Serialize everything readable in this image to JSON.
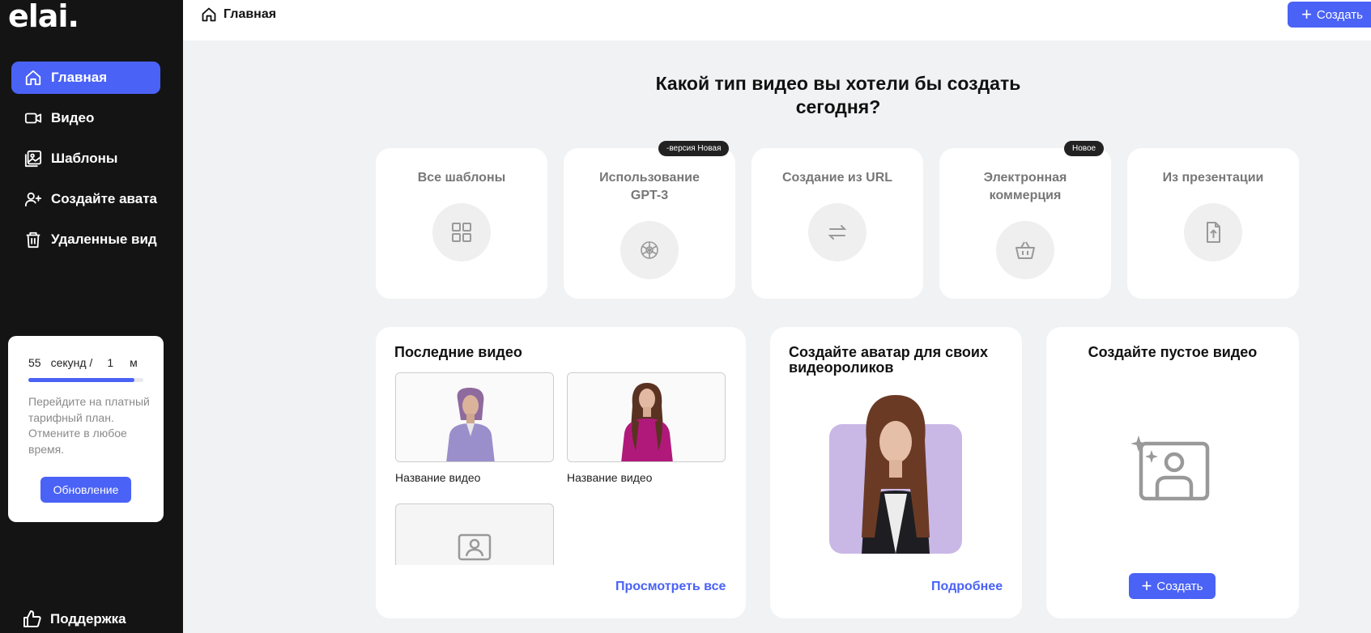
{
  "sidebar": {
    "logo": "elai.",
    "nav": [
      {
        "label": "Главная",
        "icon": "home-icon",
        "active": true
      },
      {
        "label": "Видео",
        "icon": "video-camera-icon"
      },
      {
        "label": "Шаблоны",
        "icon": "images-icon"
      },
      {
        "label": "Создайте авата",
        "icon": "user-plus-icon"
      },
      {
        "label": "Удаленные вид",
        "icon": "trash-icon"
      }
    ],
    "trial": {
      "seconds_value": "55",
      "seconds_label": "секунд /",
      "minutes_value": "1",
      "minutes_label": "м",
      "progress": 0.92,
      "text": "Перейдите на платный тарифный план. Отмените в любое время.",
      "button": "Обновление"
    },
    "support": "Поддержка"
  },
  "header": {
    "crumb": "Главная",
    "create_button": "Создать"
  },
  "main": {
    "question": "Какой тип видео вы хотели бы создать сегодня?",
    "types": [
      {
        "title": "Все шаблоны",
        "icon": "grid-icon",
        "badge": ""
      },
      {
        "title": "Использование GPT-3",
        "icon": "openai-icon",
        "badge": "-версия Новая"
      },
      {
        "title": "Создание из URL",
        "icon": "arrows-exchange-icon",
        "badge": ""
      },
      {
        "title": "Электронная коммерция",
        "icon": "basket-icon",
        "badge": "Новое"
      },
      {
        "title": "Из презентации",
        "icon": "file-upload-icon",
        "badge": ""
      }
    ],
    "recent": {
      "title": "Последние видео",
      "videos": [
        {
          "label": "Название видео"
        },
        {
          "label": "Название видео"
        }
      ],
      "view_all": "Просмотреть все"
    },
    "avatar": {
      "title": "Создайте аватар для своих видеороликов",
      "more": "Подробнее"
    },
    "blank": {
      "title": "Создайте пустое видео",
      "button": "Создать"
    }
  },
  "colors": {
    "accent": "#4a62f5",
    "sidebar_bg": "#141414",
    "page_bg": "#f0f2f3"
  }
}
